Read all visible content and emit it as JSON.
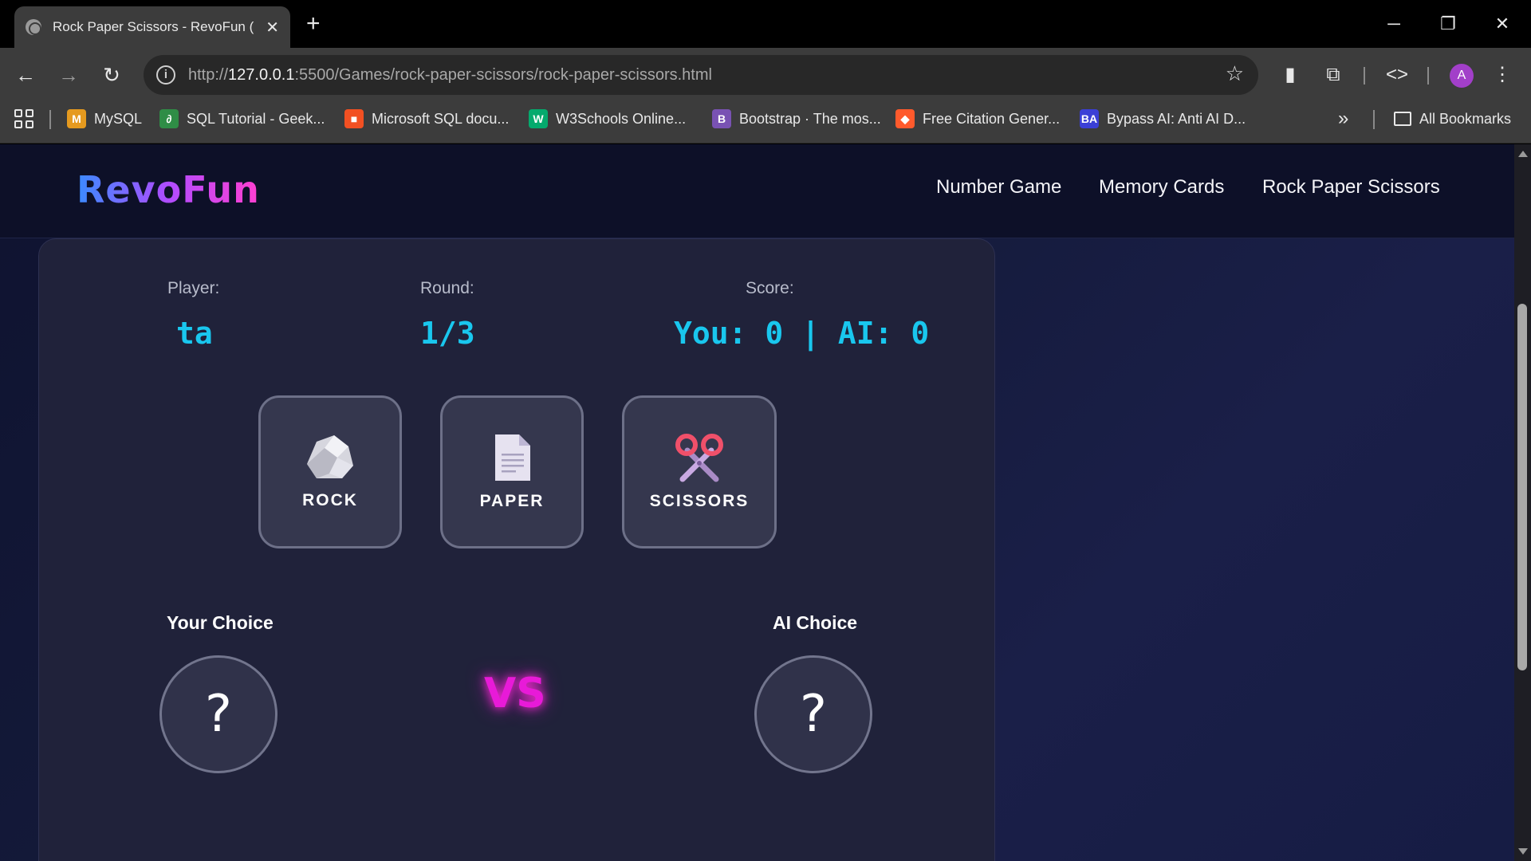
{
  "browser": {
    "tab_title": "Rock Paper Scissors - RevoFun (",
    "url_prefix": "http://",
    "url_host": "127.0.0.1",
    "url_rest": ":5500/Games/rock-paper-scissors/rock-paper-scissors.html",
    "avatar_letter": "A",
    "bookmarks": [
      {
        "label": "MySQL",
        "icon": "mysql-icon",
        "color": "#e59a1f"
      },
      {
        "label": "SQL Tutorial - Geek...",
        "icon": "geeksforgeeks-icon",
        "color": "#2f8d46"
      },
      {
        "label": "Microsoft SQL docu...",
        "icon": "microsoft-icon",
        "color": "#f25022"
      },
      {
        "label": "W3Schools Online...",
        "icon": "w3schools-icon",
        "color": "#04aa6d"
      },
      {
        "label": "Bootstrap · The mos...",
        "icon": "bootstrap-icon",
        "color": "#7952b3"
      },
      {
        "label": "Free Citation Gener...",
        "icon": "citation-icon",
        "color": "#ff5a2c"
      },
      {
        "label": "Bypass AI: Anti AI D...",
        "icon": "bypass-ai-icon",
        "color": "#3b3fd6"
      }
    ],
    "overflow_glyph": "»",
    "all_bookmarks_label": "All Bookmarks"
  },
  "site": {
    "logo": "RevoFun",
    "nav": [
      "Number Game",
      "Memory Cards",
      "Rock Paper Scissors"
    ]
  },
  "game": {
    "player_label": "Player:",
    "player_value": "ta",
    "round_label": "Round:",
    "round_value": "1/3",
    "score_label": "Score:",
    "score_value": "You: 0 | AI: 0",
    "choices": [
      "ROCK",
      "PAPER",
      "SCISSORS"
    ],
    "your_choice_label": "Your Choice",
    "ai_choice_label": "AI Choice",
    "your_choice_value": "?",
    "ai_choice_value": "?",
    "vs_label": "VS"
  }
}
